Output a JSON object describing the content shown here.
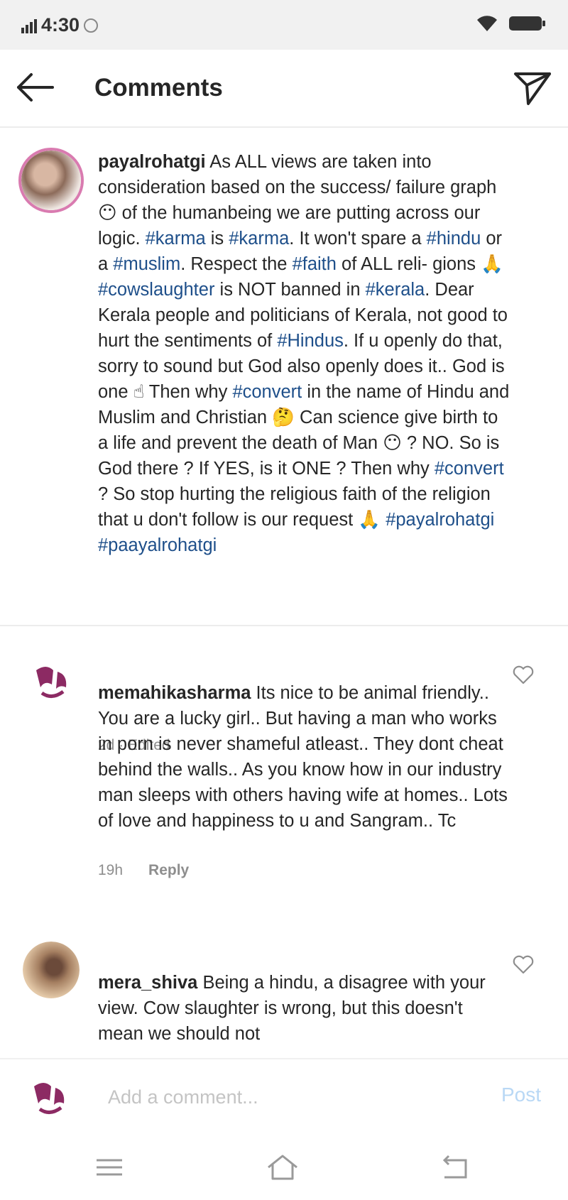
{
  "status": {
    "time": "4:30"
  },
  "header": {
    "title": "Comments",
    "back_icon": "arrow-left-icon",
    "send_icon": "paper-plane-icon"
  },
  "caption": {
    "username": "payalrohatgi",
    "segments": [
      " As ALL views are taken into consideration based on the success/ failure graph ",
      "😶",
      " of the humanbeing we are putting across our logic.  ",
      "#karma",
      " is ",
      "#karma",
      ". It won't spare a ",
      "#hindu",
      " or a ",
      "#muslim",
      ". Respect the ",
      "#faith",
      " of ALL reli- gions ",
      "🙏",
      " ",
      "#cowslaughter",
      " is NOT banned in ",
      "#kerala",
      ". Dear Kerala people and politicians of Kerala, not good to hurt the sentiments of ",
      "#Hindus",
      ". If u openly do that, sorry to sound but God also openly does it.. God is one ",
      "☝",
      " Then why ",
      "#convert",
      " in the name of Hindu and Muslim and Christian ",
      "🤔",
      " Can science give birth to a life and prevent the death of Man ",
      "😶",
      " ? NO.  So is God there ? If YES, is it ONE ?  Then why ",
      "#convert",
      " ? So stop hurting the religious faith of the religion that u don't follow is our request ",
      "🙏",
      " ",
      "#payalrohatgi",
      " ",
      "#paayalrohatgi"
    ],
    "meta": "2d · Edited"
  },
  "comments": [
    {
      "username": "memahikasharma",
      "text": " Its nice to be animal friendly.. You are a lucky girl.. But having a man who works in porn is never shameful  atleast.. They dont cheat behind the walls.. As you know how in our industry man sleeps with others having wife at homes.. Lots of love and happiness to u and Sangram.. Tc",
      "time": "19h",
      "reply_label": "Reply"
    },
    {
      "username": "mera_shiva",
      "text": " Being a hindu, a disagree with your view. Cow slaughter is wrong, but this doesn't mean we should not"
    }
  ],
  "composer": {
    "placeholder": "Add a comment...",
    "post_label": "Post"
  },
  "colors": {
    "hashtag": "#1e4f8a",
    "post_disabled": "#b9d8f5",
    "avatar_ring": "#d97bb0",
    "mahika_brand": "#8c2a63"
  },
  "icons": [
    "arrow-left-icon",
    "paper-plane-icon",
    "heart-icon",
    "menu-icon",
    "home-icon",
    "back-nav-icon"
  ]
}
